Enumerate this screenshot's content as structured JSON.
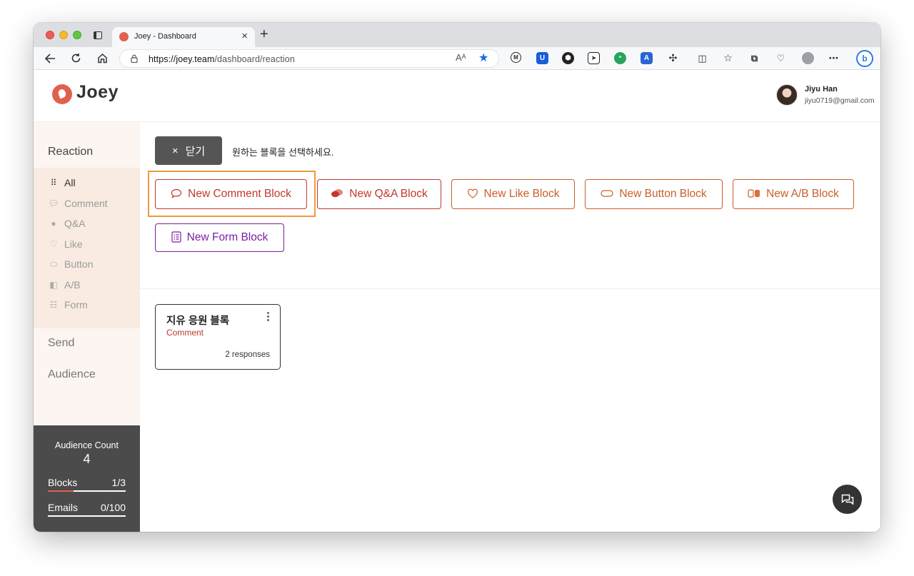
{
  "browser": {
    "tab_title": "Joey - Dashboard",
    "new_tab": "+",
    "tab_close": "×",
    "url_host": "https://joey.team",
    "url_path": "/dashboard/reaction",
    "read_aloud": "Aᴬ"
  },
  "app": {
    "logo": "Joey",
    "user_name": "Jiyu Han",
    "user_email": "jiyu0719@gmail.com"
  },
  "sidebar": {
    "reaction_title": "Reaction",
    "items": [
      {
        "label": "All",
        "icon": "grid-icon"
      },
      {
        "label": "Comment",
        "icon": "speech-bubble-icon"
      },
      {
        "label": "Q&A",
        "icon": "chat-bubbles-icon"
      },
      {
        "label": "Like",
        "icon": "heart-icon"
      },
      {
        "label": "Button",
        "icon": "pill-icon"
      },
      {
        "label": "A/B",
        "icon": "ab-icon"
      },
      {
        "label": "Form",
        "icon": "form-icon"
      }
    ],
    "send": "Send",
    "audience": "Audience",
    "audience_count_label": "Audience Count",
    "audience_count_value": "4",
    "blocks_label": "Blocks",
    "blocks_value": "1/3",
    "blocks_progress": 0.333,
    "emails_label": "Emails",
    "emails_value": "0/100",
    "emails_progress": 0
  },
  "main": {
    "close_label": "닫기",
    "close_icon": "×",
    "hint": "원하는 블록을 선택하세요.",
    "block_buttons": {
      "comment": "New Comment Block",
      "qa": "New Q&A Block",
      "like": "New Like Block",
      "button": "New Button Block",
      "ab": "New A/B Block",
      "form": "New Form Block"
    },
    "colors": {
      "comment": "#c0392b",
      "qa": "#c0392b",
      "orange": "#c8602a",
      "form": "#7b1fa2",
      "highlight": "#ef9a3c"
    }
  },
  "card": {
    "title": "지유 응원 블록",
    "type": "Comment",
    "responses": "2 responses"
  }
}
